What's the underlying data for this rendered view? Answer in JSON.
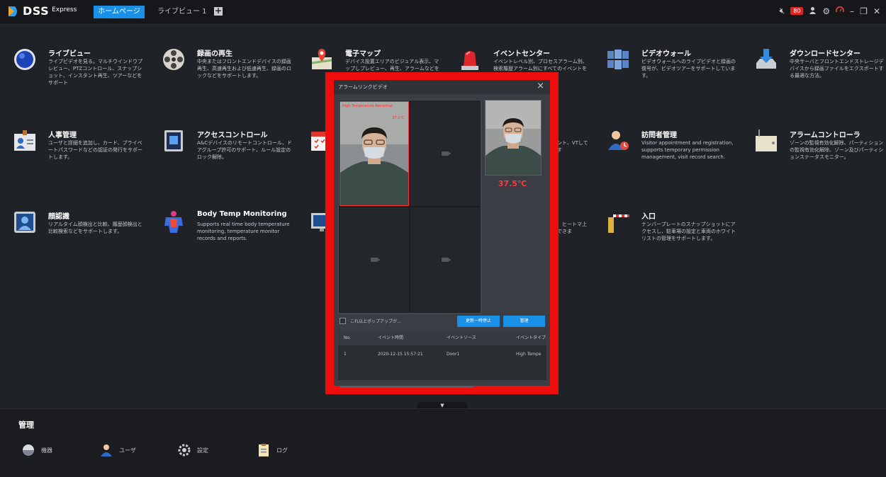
{
  "header": {
    "logo_text": "DSS",
    "logo_sub": "Express",
    "tabs": [
      {
        "label": "ホームページ",
        "active": true
      },
      {
        "label": "ライブビュー 1",
        "active": false
      }
    ],
    "add_tab_label": "+",
    "notification_count": "80"
  },
  "apps": [
    {
      "title": "ライブビュー",
      "desc": "ライブビデオを見る。マルチウインドウプレビュー、PTZコントロール、スナップショット、インスタント再生、ツアーなどをサポート",
      "icon": "live-view-icon"
    },
    {
      "title": "録画の再生",
      "desc": "中央またはフロントエンドデバイスの録画再生、高速再生および低速再生、録画のロックなどをサポートします。",
      "icon": "playback-icon"
    },
    {
      "title": "電子マップ",
      "desc": "デバイス設置エリアのビジュアル表示、マップしプレビュー、再生、アラームなどをサポー",
      "icon": "map-icon"
    },
    {
      "title": "イベントセンター",
      "desc": "イベントレベル別、プロセスアラーム別、検索履歴アラーム別にすべてのイベントをリス",
      "icon": "alarm-light-icon"
    },
    {
      "title": "ビデオウォール",
      "desc": "ビデオウォールへのライブビデオと録画の復号が、ビデオツアーをサポートしています。",
      "icon": "video-wall-icon"
    },
    {
      "title": "ダウンロードセンター",
      "desc": "中央サーバとフロントエンドストレージデバイスから録画ファイルをエクスポートする最適な方法。",
      "icon": "download-icon"
    },
    {
      "title": "人事管理",
      "desc": "ユーザと詳細を追加し、カード、プライベートパスワードなどの認証の発行をサポートします。",
      "icon": "personnel-card-icon"
    },
    {
      "title": "アクセスコントロール",
      "desc": "A&Cデバイスのリモートコントロール、ドアグループ許可のサポート、ルール設定のロック解除。",
      "icon": "access-control-icon"
    },
    {
      "title": "",
      "desc": "",
      "icon": "calendar-icon"
    },
    {
      "title": "",
      "desc": "ジメント、VTしています",
      "icon": ""
    },
    {
      "title": "訪問者管理",
      "desc": "Visitor appointment and registration, supports temporary permission management, visit record search.",
      "icon": "visitor-icon"
    },
    {
      "title": "アラームコントローラ",
      "desc": "ゾーンの監視有効化解除、パーティションの監視有効化解除、ゾーン及びパーティションステータスモニター。",
      "icon": "alarm-controller-icon"
    },
    {
      "title": "顔認識",
      "desc": "リアルタイム顔検出と比較、履歴顔検出と比較検索などをサポートします。",
      "icon": "face-recognition-icon"
    },
    {
      "title": "Body Temp Monitoring",
      "desc": "Supports real time body temperature monitoring, temperature monitor records and reports.",
      "icon": "body-temp-icon"
    },
    {
      "title": "",
      "desc": "",
      "icon": "monitor-icon"
    },
    {
      "title": "",
      "desc": "計を、ヒートマ上把握できま",
      "icon": ""
    },
    {
      "title": "入口",
      "desc": "ナンバープレートのスナップショットにアクセスし、駐車場の設定と車両のホワイトリストの管理をサポートします。",
      "icon": "barrier-gate-icon"
    }
  ],
  "management": {
    "title": "管理",
    "items": [
      {
        "label": "機器",
        "icon": "device-icon"
      },
      {
        "label": "ユーザ",
        "icon": "user-icon"
      },
      {
        "label": "設定",
        "icon": "settings-icon"
      },
      {
        "label": "ログ",
        "icon": "log-icon"
      }
    ]
  },
  "popup": {
    "title": "アラームリンクビデオ",
    "alert_label": "High Temperature Abnormal",
    "alert_value": "37.5℃",
    "temperature": "37.5℃",
    "checkbox_label": "これ以上ポップアップが...",
    "pause_button": "更新一時停止",
    "manage_button": "管理",
    "table": {
      "headers": [
        "No.",
        "イベント時間",
        "イベントソース",
        "イベントタイプ"
      ],
      "rows": [
        [
          "1",
          "2020-12-15 15:57:21",
          "Door1",
          "High Tempe"
        ]
      ]
    }
  },
  "colors": {
    "accent": "#1890e8",
    "alert": "#ec0d0d"
  }
}
